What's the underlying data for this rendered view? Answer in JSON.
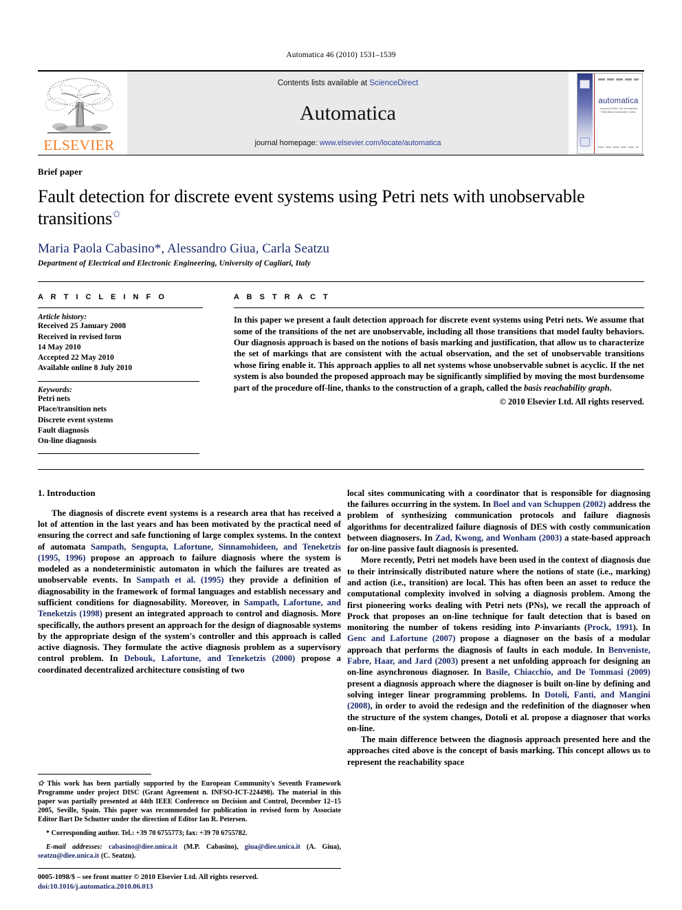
{
  "running_head": "Automatica 46 (2010) 1531–1539",
  "banner": {
    "publisher_logo_name": "elsevier-tree-logo",
    "publisher_name": "ELSEVIER",
    "contents_prefix": "Contents lists available at ",
    "contents_link": "ScienceDirect",
    "journal_name": "Automatica",
    "homepage_prefix": "journal homepage: ",
    "homepage_url": "www.elsevier.com/locate/automatica",
    "cover": {
      "title": "automatica",
      "subtitle": "a journal of IFAC, the International Federation of Automatic Control"
    }
  },
  "article": {
    "type_label": "Brief paper",
    "title": "Fault detection for discrete event systems using Petri nets with unobservable transitions",
    "title_footnote_marker": "✩",
    "authors": "Maria Paola Cabasino*, Alessandro Giua, Carla Seatzu",
    "affiliation": "Department of Electrical and Electronic Engineering, University of Cagliari, Italy"
  },
  "article_info": {
    "heading": "A R T I C L E   I N F O",
    "history_label": "Article history:",
    "history_lines": [
      "Received 25 January 2008",
      "Received in revised form",
      "14 May 2010",
      "Accepted 22 May 2010",
      "Available online 8 July 2010"
    ],
    "keywords_label": "Keywords:",
    "keywords": [
      "Petri nets",
      "Place/transition nets",
      "Discrete event systems",
      "Fault diagnosis",
      "On-line diagnosis"
    ]
  },
  "abstract": {
    "heading": "A B S T R A C T",
    "text_part1": "In this paper we present a fault detection approach for discrete event systems using Petri nets. We assume that some of the transitions of the net are unobservable, including all those transitions that model faulty behaviors. Our diagnosis approach is based on the notions of basis marking and justification, that allow us to characterize the set of markings that are consistent with the actual observation, and the set of unobservable transitions whose firing enable it. This approach applies to all net systems whose unobservable subnet is acyclic. If the net system is also bounded the proposed approach may be significantly simplified by moving the most burdensome part of the procedure off-line, thanks to the construction of a graph, called the ",
    "text_italic": "basis reachability graph",
    "text_part2": ".",
    "copyright": "© 2010 Elsevier Ltd. All rights reserved."
  },
  "body": {
    "section_number_title": "1.  Introduction",
    "left_paragraphs": [
      {
        "segments": [
          {
            "t": "The diagnosis of discrete event systems is a research area that has received a lot of attention in the last years and has been motivated by the practical need of ensuring the correct and safe functioning of large complex systems. In the context of automata ",
            "s": "plain"
          },
          {
            "t": "Sampath, Sengupta, Lafortune, Sinnamohideen, and Teneketzis (1995, 1996)",
            "s": "cite"
          },
          {
            "t": " propose an approach to failure diagnosis where the system is modeled as a nondeterministic automaton in which the failures are treated as unobservable events. In ",
            "s": "plain"
          },
          {
            "t": "Sampath et al. (1995)",
            "s": "cite"
          },
          {
            "t": " they provide a definition of diagnosability in the framework of formal languages and establish necessary and sufficient conditions for diagnosability. Moreover, in ",
            "s": "plain"
          },
          {
            "t": "Sampath, Lafortune, and Teneketzis (1998)",
            "s": "cite"
          },
          {
            "t": " present an integrated approach to control and diagnosis. More specifically, the authors present an approach for the design of diagnosable systems by the appropriate design of the system's controller and this approach is called active diagnosis. They formulate the active diagnosis problem as a supervisory control problem. In ",
            "s": "plain"
          },
          {
            "t": "Debouk, Lafortune, and Teneketzis (2000)",
            "s": "cite"
          },
          {
            "t": " propose a coordinated decentralized architecture consisting of two",
            "s": "plain"
          }
        ]
      }
    ],
    "right_paragraphs": [
      {
        "indent": false,
        "segments": [
          {
            "t": "local sites communicating with a coordinator that is responsible for diagnosing the failures occurring in the system. In ",
            "s": "plain"
          },
          {
            "t": "Boel and van Schuppen (2002)",
            "s": "cite"
          },
          {
            "t": " address the problem of synthesizing communication protocols and failure diagnosis algorithms for decentralized failure diagnosis of DES with costly communication between diagnosers. In ",
            "s": "plain"
          },
          {
            "t": "Zad, Kwong, and Wonham (2003)",
            "s": "cite"
          },
          {
            "t": " a state-based approach for on-line passive fault diagnosis is presented.",
            "s": "plain"
          }
        ]
      },
      {
        "indent": true,
        "segments": [
          {
            "t": "More recently, Petri net models have been used in the context of diagnosis due to their intrinsically distributed nature where the notions of state (i.e., marking) and action (i.e., transition) are local. This has often been an asset to reduce the computational complexity involved in solving a diagnosis problem. Among the first pioneering works dealing with Petri nets (PNs), we recall the approach of Prock that proposes an on-line technique for fault detection that is based on monitoring the number of tokens residing into ",
            "s": "plain"
          },
          {
            "t": "P",
            "s": "ital"
          },
          {
            "t": "-invariants (",
            "s": "plain"
          },
          {
            "t": "Prock, 1991",
            "s": "cite"
          },
          {
            "t": "). In ",
            "s": "plain"
          },
          {
            "t": "Genc and Lafortune (2007)",
            "s": "cite"
          },
          {
            "t": " propose a diagnoser on the basis of a modular approach that performs the diagnosis of faults in each module. In ",
            "s": "plain"
          },
          {
            "t": "Benveniste, Fabre, Haar, and Jard (2003)",
            "s": "cite"
          },
          {
            "t": " present a net unfolding approach for designing an on-line asynchronous diagnoser. In ",
            "s": "plain"
          },
          {
            "t": "Basile, Chiacchio, and De Tommasi (2009)",
            "s": "cite"
          },
          {
            "t": " present a diagnosis approach where the diagnoser is built on-line by defining and solving integer linear programming problems. In ",
            "s": "plain"
          },
          {
            "t": "Dotoli, Fanti, and Mangini (2008)",
            "s": "cite"
          },
          {
            "t": ", in order to avoid the redesign and the redefinition of the diagnoser when the structure of the system changes, Dotoli et al. propose a diagnoser that works on-line.",
            "s": "plain"
          }
        ]
      },
      {
        "indent": true,
        "segments": [
          {
            "t": "The main difference between the diagnosis approach presented here and the approaches cited above is the concept of basis marking. This concept allows us to represent the reachability space",
            "s": "plain"
          }
        ]
      }
    ]
  },
  "footnotes": {
    "star_marker": "✩",
    "funding": "This work has been partially supported by the European Community's Seventh Framework Programme under project DISC (Grant Agreement n. INFSO-ICT-224498). The material in this paper was partially presented at 44th IEEE Conference on Decision and Control, December 12–15 2005, Seville, Spain. This paper was recommended for publication in revised form by Associate Editor Bart De Schutter under the direction of Editor Ian R. Petersen.",
    "corresponding_marker": "*",
    "corresponding": "Corresponding author. Tel.: +39 70 6755773; fax: +39 70 6755782.",
    "email_label": "E-mail addresses:",
    "emails": [
      {
        "addr": "cabasino@diee.unica.it",
        "who": " (M.P. Cabasino), "
      },
      {
        "addr": "giua@diee.unica.it",
        "who": " (A. Giua), "
      },
      {
        "addr": "seatzu@diee.unica.it",
        "who": " (C. Seatzu)."
      }
    ]
  },
  "imprint": {
    "issn_line": "0005-1098/$ – see front matter © 2010 Elsevier Ltd. All rights reserved.",
    "doi_line": "doi:10.1016/j.automatica.2010.06.013"
  },
  "colors": {
    "link_blue": "#1b2a6b",
    "banner_gray": "#e9e9e9",
    "elsevier_orange": "#F47B20"
  }
}
